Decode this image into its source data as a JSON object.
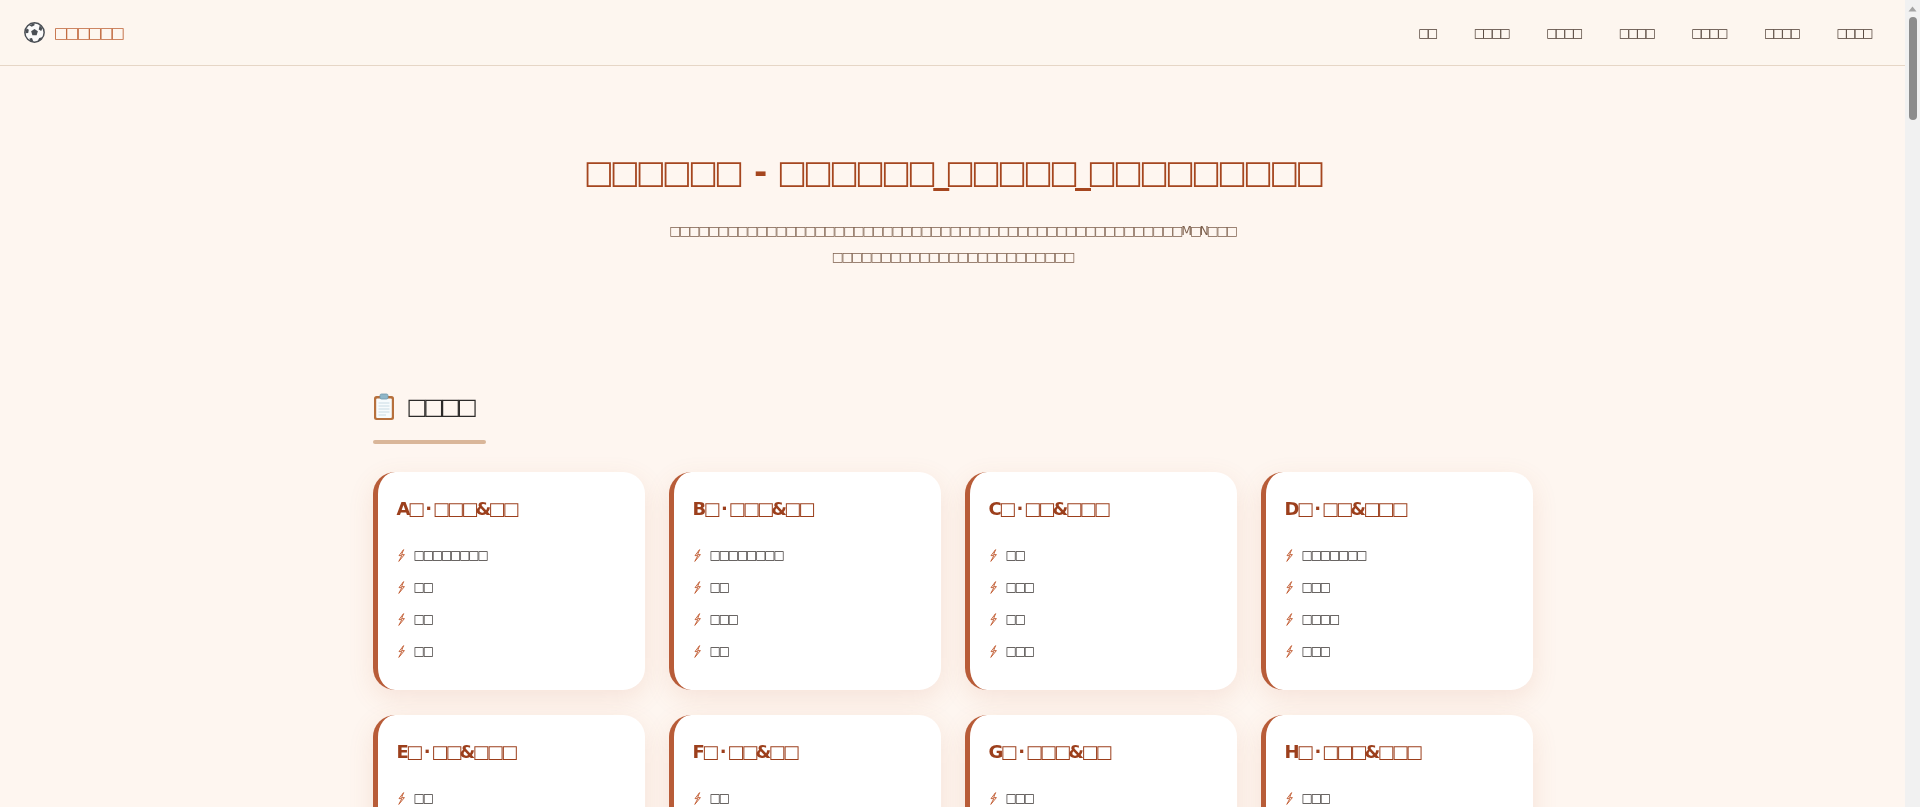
{
  "header": {
    "logo": "□□□□□□",
    "nav": [
      "□□",
      "□□□□",
      "□□□□",
      "□□□□",
      "□□□□",
      "□□□□",
      "□□□□"
    ]
  },
  "hero": {
    "title": "□□□□□□ - □□□□□□_□□□□□_□□□□□□□□□",
    "subtitle": "□□□□□□□□□□□□□□□□□□□□□□□□□□□□□□□□□□□□□□□□□□□□□□□□□□□□□M□N□□□□□□□□□□□□□□□□□□□□□□□□□□□□"
  },
  "section": {
    "title": "□□□□",
    "groups": [
      {
        "title": "A□ · □□□&□□",
        "items": [
          "□□□□□□□□",
          "□□",
          "□□",
          "□□"
        ]
      },
      {
        "title": "B□ · □□□&□□",
        "items": [
          "□□□□□□□□",
          "□□",
          "□□□",
          "□□"
        ]
      },
      {
        "title": "C□ · □□&□□□",
        "items": [
          "□□",
          "□□□",
          "□□",
          "□□□"
        ]
      },
      {
        "title": "D□ · □□&□□□",
        "items": [
          "□□□□□□□",
          "□□□",
          "□□□□",
          "□□□"
        ]
      },
      {
        "title": "E□ · □□&□□□",
        "items": [
          "□□"
        ]
      },
      {
        "title": "F□ · □□&□□",
        "items": [
          "□□"
        ]
      },
      {
        "title": "G□ · □□□&□□",
        "items": [
          "□□□"
        ]
      },
      {
        "title": "H□ · □□□&□□□",
        "items": [
          "□□□"
        ]
      }
    ]
  }
}
